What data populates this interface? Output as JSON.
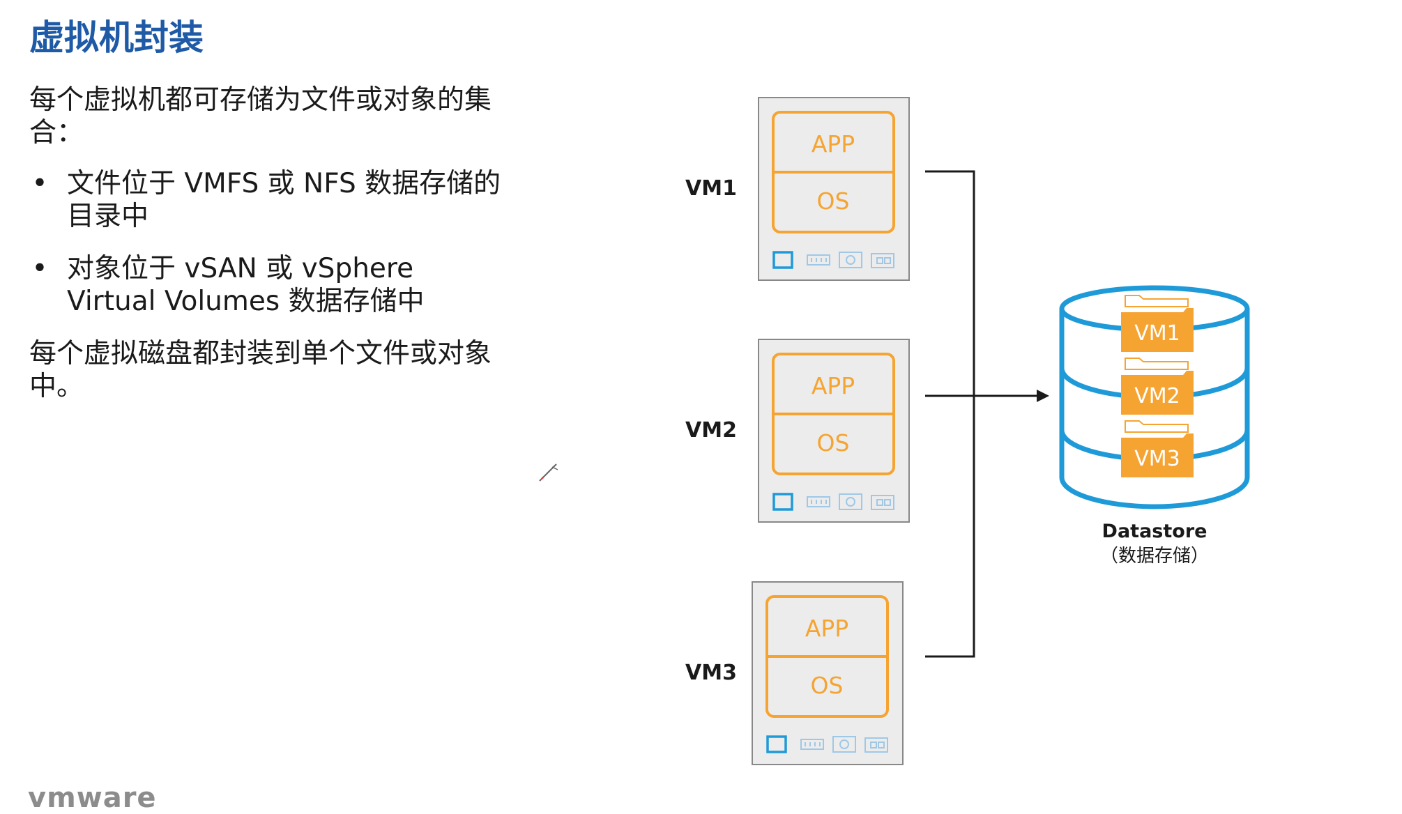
{
  "slide": {
    "title": "虚拟机封装",
    "intro": "每个虚拟机都可存储为文件或对象的集合：",
    "bullets": [
      "文件位于 VMFS 或 NFS 数据存储的目录中",
      "对象位于 vSAN 或 vSphere Virtual Volumes 数据存储中"
    ],
    "closing": "每个虚拟磁盘都封装到单个文件或对象中。",
    "logo": "vmware"
  },
  "diagram": {
    "vms": [
      {
        "label": "VM1",
        "app": "APP",
        "os": "OS"
      },
      {
        "label": "VM2",
        "app": "APP",
        "os": "OS"
      },
      {
        "label": "VM3",
        "app": "APP",
        "os": "OS"
      }
    ],
    "datastore": {
      "name": "Datastore",
      "subtitle": "（数据存储）",
      "folders": [
        "VM1",
        "VM2",
        "VM3"
      ]
    },
    "colors": {
      "orange": "#f5a432",
      "blue": "#1f9ad8",
      "vm_box_bg": "#ececec",
      "vm_box_border": "#888888",
      "title": "#1f5aa6"
    },
    "hardware_icons": [
      "cpu-icon",
      "memory-icon",
      "disk-icon",
      "network-icon"
    ]
  }
}
